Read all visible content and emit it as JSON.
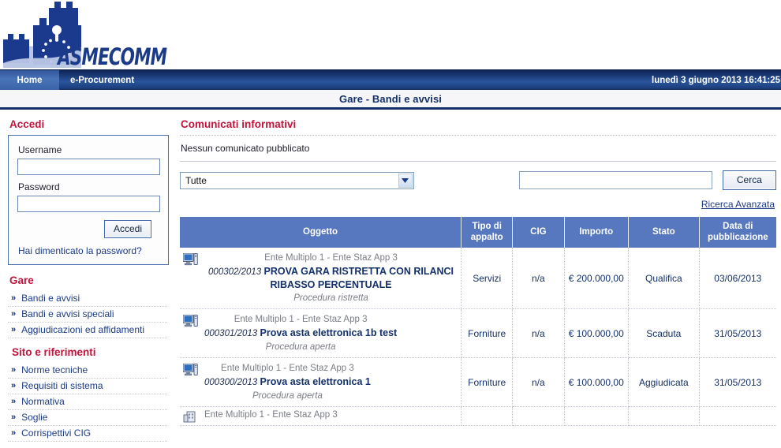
{
  "brand": {
    "name": "ASMECOMM",
    "logo_icon": "castle-eu-stars-logo"
  },
  "nav": {
    "tabs": [
      {
        "label": "Home",
        "active": true
      },
      {
        "label": "e-Procurement",
        "active": false
      }
    ],
    "datetime": "lunedì 3 giugno 2013 16:41:25"
  },
  "page_title": "Gare - Bandi e avvisi",
  "sidebar": {
    "login": {
      "heading": "Accedi",
      "username_label": "Username",
      "username_value": "",
      "password_label": "Password",
      "password_value": "",
      "submit_label": "Accedi",
      "forgot_label": "Hai dimenticato la password?"
    },
    "sections": [
      {
        "heading": "Gare",
        "items": [
          {
            "label": "Bandi e avvisi"
          },
          {
            "label": "Bandi e avvisi speciali"
          },
          {
            "label": "Aggiudicazioni ed affidamenti"
          }
        ]
      },
      {
        "heading": "Sito e riferimenti",
        "items": [
          {
            "label": "Norme tecniche"
          },
          {
            "label": "Requisiti di sistema"
          },
          {
            "label": "Normativa"
          },
          {
            "label": "Soglie"
          },
          {
            "label": "Corrispettivi CIG"
          }
        ]
      }
    ],
    "bullet_glyph": "»"
  },
  "main": {
    "comunicati_heading": "Comunicati informativi",
    "comunicati_empty": "Nessun comunicato pubblicato",
    "filter_select": {
      "value": "Tutte",
      "options": [
        "Tutte"
      ]
    },
    "search_input": {
      "value": "",
      "placeholder": ""
    },
    "search_button": "Cerca",
    "advanced_search": "Ricerca Avanzata",
    "table": {
      "columns": [
        "Oggetto",
        "Tipo di appalto",
        "CIG",
        "Importo",
        "Stato",
        "Data di pubblicazione"
      ],
      "rows": [
        {
          "icon": "monitor-tower-icon",
          "ente": "Ente Multiplo 1 - Ente Staz App 3",
          "code": "000302/2013",
          "title": "PROVA GARA RISTRETTA CON RILANCI RIBASSO PERCENTUALE",
          "procedura": "Procedura ristretta",
          "tipo": "Servizi",
          "cig": "n/a",
          "importo": "€ 200.000,00",
          "stato": "Qualifica",
          "data": "03/06/2013"
        },
        {
          "icon": "monitor-tower-icon",
          "ente": "Ente Multiplo 1 - Ente Staz App 3",
          "code": "000301/2013",
          "title": "Prova asta elettronica 1b test",
          "procedura": "Procedura aperta",
          "tipo": "Forniture",
          "cig": "n/a",
          "importo": "€ 100.000,00",
          "stato": "Scaduta",
          "data": "31/05/2013"
        },
        {
          "icon": "monitor-tower-icon",
          "ente": "Ente Multiplo 1 - Ente Staz App 3",
          "code": "000300/2013",
          "title": "Prova asta elettronica 1",
          "procedura": "Procedura aperta",
          "tipo": "Forniture",
          "cig": "n/a",
          "importo": "€ 100.000,00",
          "stato": "Aggiudicata",
          "data": "31/05/2013"
        }
      ],
      "partial_row": {
        "icon": "building-icon",
        "ente": "Ente Multiplo 1 - Ente Staz App 3"
      }
    }
  },
  "colors": {
    "navy": "#14306a",
    "nav_gradient_dark": "#0e2556",
    "nav_gradient_light": "#2a559c",
    "heading_red": "#c0143c",
    "table_header_blue": "#5777bf",
    "link_blue": "#1b3a87",
    "muted_grey": "#7a7d86"
  }
}
